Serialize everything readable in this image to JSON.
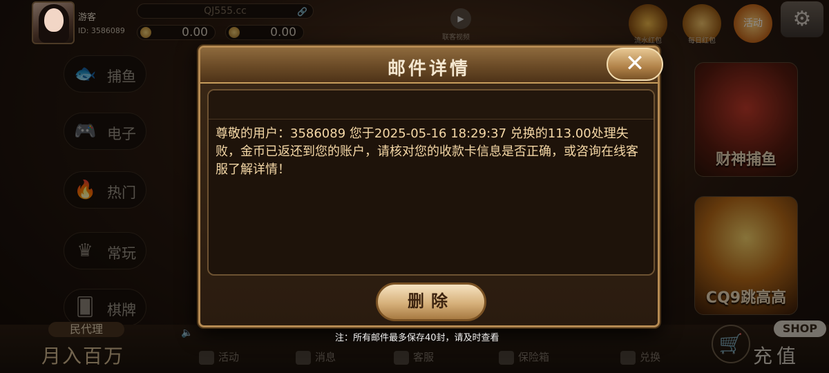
{
  "header": {
    "username": "游客",
    "user_id": "ID: 3586089",
    "url": "QJ555.cc",
    "coins": [
      "0.00",
      "0.00"
    ],
    "video_label": "联客视频",
    "top_icons": [
      {
        "label": "流水红包"
      },
      {
        "label": "每日红包"
      },
      {
        "label": "活动"
      }
    ]
  },
  "sidebar": {
    "items": [
      {
        "label": "捕鱼",
        "icon": "fish-icon"
      },
      {
        "label": "电子",
        "icon": "gamepad-icon"
      },
      {
        "label": "热门",
        "icon": "fire-icon"
      },
      {
        "label": "常玩",
        "icon": "crown-icon"
      },
      {
        "label": "棋牌",
        "icon": "cards-icon"
      }
    ]
  },
  "games": [
    {
      "label": "财神捕鱼"
    },
    {
      "label": "CQ9跳高高"
    }
  ],
  "bottom": {
    "agent_tag": "民代理",
    "agent_big": "月入百万",
    "nav": [
      {
        "label": "活动",
        "icon": "gift-icon"
      },
      {
        "label": "消息",
        "icon": "bell-icon"
      },
      {
        "label": "客服",
        "icon": "headset-icon"
      },
      {
        "label": "保险箱",
        "icon": "safe-icon"
      },
      {
        "label": "兑换",
        "icon": "exchange-icon"
      }
    ],
    "shop": "SHOP",
    "recharge": "充值"
  },
  "modal": {
    "title": "邮件详情",
    "close_label": "✕",
    "message": "尊敬的用户：3586089 您于2025-05-16 18:29:37 兑换的113.00处理失败，金币已返还到您的账户，请核对您的收款卡信息是否正确，或咨询在线客服了解详情！",
    "delete_label": "删除",
    "note": "注：所有邮件最多保存40封，请及时查看"
  }
}
